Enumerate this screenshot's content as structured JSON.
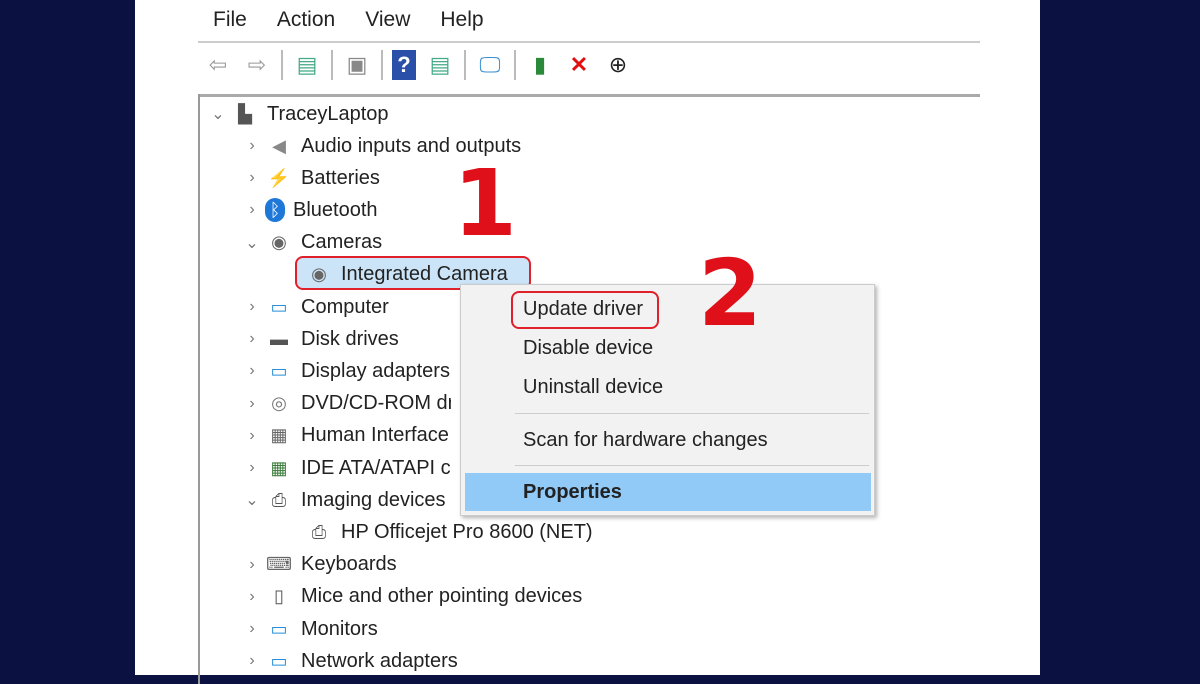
{
  "menu": [
    "File",
    "Action",
    "View",
    "Help"
  ],
  "toolbar": [
    "back-icon",
    "forward-icon",
    "show-hide-console-tree-icon",
    "properties-icon",
    "help-icon",
    "show-hide-action-pane-icon",
    "scan-hardware-icon",
    "update-driver-icon",
    "uninstall-icon",
    "download-icon"
  ],
  "tree": {
    "root": "TraceyLaptop",
    "items": [
      {
        "label": "Audio inputs and outputs",
        "icon": "speaker-icon",
        "expanded": false
      },
      {
        "label": "Batteries",
        "icon": "battery-icon",
        "expanded": false
      },
      {
        "label": "Bluetooth",
        "icon": "bluetooth-icon",
        "expanded": false
      },
      {
        "label": "Cameras",
        "icon": "camera-icon",
        "expanded": true
      },
      {
        "label": "Integrated Camera",
        "icon": "camera-icon",
        "child": true,
        "selected": true
      },
      {
        "label": "Computer",
        "icon": "monitor-icon",
        "expanded": false
      },
      {
        "label": "Disk drives",
        "icon": "disk-icon",
        "expanded": false
      },
      {
        "label": "Display adapters",
        "icon": "display-adapter-icon",
        "expanded": false
      },
      {
        "label": "DVD/CD-ROM drives",
        "icon": "dvd-icon",
        "expanded": false
      },
      {
        "label": "Human Interface Devices",
        "icon": "hid-icon",
        "expanded": false
      },
      {
        "label": "IDE ATA/ATAPI controllers",
        "icon": "ide-icon",
        "expanded": false
      },
      {
        "label": "Imaging devices",
        "icon": "printer-icon",
        "expanded": true
      },
      {
        "label": "HP Officejet Pro 8600 (NET)",
        "icon": "printer-icon",
        "child": true
      },
      {
        "label": "Keyboards",
        "icon": "keyboard-icon",
        "expanded": false
      },
      {
        "label": "Mice and other pointing devices",
        "icon": "mouse-icon",
        "expanded": false
      },
      {
        "label": "Monitors",
        "icon": "monitor-icon",
        "expanded": false
      },
      {
        "label": "Network adapters",
        "icon": "network-icon",
        "expanded": false
      }
    ]
  },
  "context_menu": {
    "update": "Update driver",
    "disable": "Disable device",
    "uninstall": "Uninstall device",
    "scan": "Scan for hardware changes",
    "properties": "Properties"
  },
  "annotations": {
    "step1": "1",
    "step2": "2"
  },
  "colors": {
    "highlight": "#e0202a",
    "selection": "#cce4f7",
    "menu_hover": "#91c9f7"
  }
}
